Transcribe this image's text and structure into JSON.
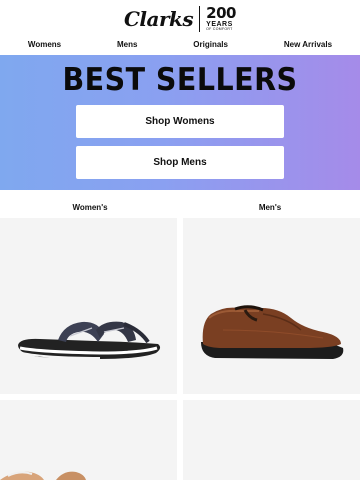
{
  "header": {
    "logo_text": "Clarks",
    "anniversary_number": "200",
    "anniversary_word": "YEARS",
    "anniversary_tagline": "OF COMFORT"
  },
  "nav": {
    "items": [
      "Womens",
      "Mens",
      "Originals",
      "New Arrivals"
    ]
  },
  "hero": {
    "title": "BEST SELLERS",
    "buttons": [
      "Shop Womens",
      "Shop Mens"
    ]
  },
  "columns": {
    "womens_label": "Women's",
    "mens_label": "Men's"
  },
  "products": [
    {
      "type": "womens-sandal",
      "icon": "flip-flop-sandal"
    },
    {
      "type": "mens-loafer",
      "icon": "brown-leather-loafer"
    },
    {
      "type": "womens-shoe",
      "icon": "shoe-partial"
    },
    {
      "type": "mens-shoe",
      "icon": "shoe-partial"
    }
  ],
  "colors": {
    "hero_gradient_start": "#7fa8ef",
    "hero_gradient_end": "#a58be9",
    "card_background": "#f4f4f4"
  }
}
